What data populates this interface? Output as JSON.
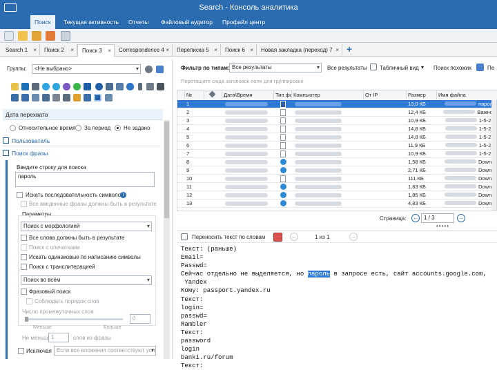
{
  "window": {
    "title": "Search - Консоль аналитика"
  },
  "ribbon": {
    "tabs": [
      "Поиск",
      "Текущая активность",
      "Отчеты",
      "Файловый аудитор",
      "Профайл центр"
    ],
    "active": 0
  },
  "doc_tabs": [
    {
      "label": "Search 1"
    },
    {
      "label": "Поиск 2"
    },
    {
      "label": "Поиск 3",
      "active": true
    },
    {
      "label": "Correspondence 4"
    },
    {
      "label": "Переписка 5"
    },
    {
      "label": "Поиск 6"
    },
    {
      "label": "Новая закладка (переход) 7"
    }
  ],
  "left": {
    "groups_label": "Группы:",
    "groups_value": "<Не выбрано>",
    "date_section": "Дата перехвата",
    "date_options": [
      "Относительное время",
      "За период",
      "Не задано"
    ],
    "date_selected": 2,
    "user_section": "Пользователь",
    "phrase_section": "Поиск фразы",
    "phrase_prompt": "Введите строку для поиска",
    "phrase_value": "пароль",
    "seq_label": "Искать последовательность символов",
    "all_phrases": "Все введенные фразы должны быть в результате",
    "params_label": "Параметры",
    "morph": "Поиск с морфологией",
    "all_words": "Все слова должны быть в результате",
    "typos": "Поиск с опечатками",
    "same_chars": "Искать одинаковые по написанию символы",
    "translit": "Поиск с транслитерацией",
    "search_all": "Поиск во всём",
    "phrase_search": "Фразовый поиск",
    "word_order": "Соблюдать порядок слов",
    "between_words": "Число промежуточных слов",
    "between_value": "0",
    "less": "Меньше",
    "more": "Больше",
    "not_less": "Не меньше",
    "not_less_value": "1",
    "words_in_phrase": "слов из фразы",
    "exclude_label": "Исключая",
    "exclude_placeholder": "Если все вложения соответствуют усл"
  },
  "filter": {
    "label": "Фильтр по типам:",
    "value": "Все результаты",
    "all_results": "Все результаты",
    "table_view": "Табличный вид",
    "similar": "Поиск похожих",
    "cut": "Пе"
  },
  "grid": {
    "group_hint": "Перетащите сюда заголовок поля для группировки",
    "columns": [
      "№",
      "",
      "Дата\\Время",
      "Тип фа",
      "Компьютер",
      "От IP",
      "Размер",
      "Имя файла"
    ],
    "rows": [
      {
        "n": "1",
        "size": "13,0 КБ",
        "file": "пароле",
        "icon": "doc-word"
      },
      {
        "n": "2",
        "size": "12,4 КБ",
        "file": "Важно..",
        "icon": "doc-white"
      },
      {
        "n": "3",
        "size": "10,9 КБ",
        "file": "1-5-21-",
        "icon": "doc-white"
      },
      {
        "n": "4",
        "size": "14,8 КБ",
        "file": "1-5-21-",
        "icon": "doc-white"
      },
      {
        "n": "5",
        "size": "14,8 КБ",
        "file": "1-5-21-",
        "icon": "doc-white"
      },
      {
        "n": "6",
        "size": "11,9 КБ",
        "file": "1-5-21-",
        "icon": "doc-white"
      },
      {
        "n": "7",
        "size": "10,9 КБ",
        "file": "1-5-21-",
        "icon": "doc-white"
      },
      {
        "n": "8",
        "size": "1,58 КБ",
        "file": "Downlo",
        "icon": "ie"
      },
      {
        "n": "9",
        "size": "2,71 КБ",
        "file": "Downlo",
        "icon": "ie"
      },
      {
        "n": "10",
        "size": "111 КБ",
        "file": "Downlo",
        "icon": "doc-white"
      },
      {
        "n": "11",
        "size": "1,83 КБ",
        "file": "Downlo",
        "icon": "ie"
      },
      {
        "n": "12",
        "size": "1,85 КБ",
        "file": "Downlo",
        "icon": "ie"
      },
      {
        "n": "13",
        "size": "4,83 КБ",
        "file": "Downlo",
        "icon": "ie"
      }
    ],
    "selected_row": 0
  },
  "pager": {
    "label": "Страница:",
    "value": "1 / 3"
  },
  "viewer": {
    "wrap_label": "Переносить текст по словам",
    "page": "1 из 1"
  },
  "text": {
    "lines": [
      "Текст: (раньше)",
      "Email=",
      "Passwd=",
      "Сейчас отдельно не выделяется, но |пароль| в запросе есть, сайт accounts.google.com,",
      " Yandex",
      "Кому: passport.yandex.ru",
      "Текст:",
      "login=",
      "passwd=",
      "Rambler",
      "Текст:",
      "password",
      "login",
      "banki.ru/forum",
      "Текст:"
    ]
  },
  "colors": {
    "accent": "#2b6cb1",
    "selection": "#2e78d6"
  }
}
